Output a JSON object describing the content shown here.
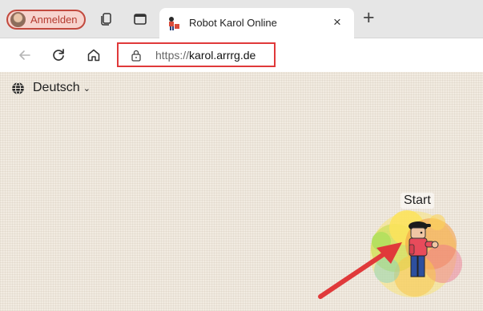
{
  "browser": {
    "signin_label": "Anmelden",
    "tab": {
      "title": "Robot Karol Online",
      "close_glyph": "×"
    },
    "new_tab_glyph": "+",
    "address": {
      "scheme": "https://",
      "host": "karol.arrrg.de"
    }
  },
  "page": {
    "language": {
      "selected": "Deutsch",
      "chevron": "⌄"
    },
    "start_label": "Start"
  },
  "colors": {
    "highlight": "#e0393a",
    "signin_border": "#c24a3f",
    "arrow": "#e0393a"
  }
}
